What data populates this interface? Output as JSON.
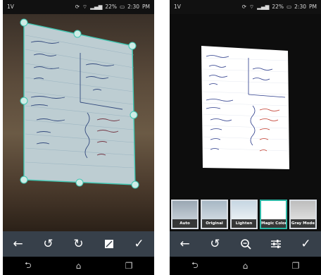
{
  "left_screen": {
    "status": {
      "carrier": "1V",
      "battery_percent": "22%",
      "time": "2:30",
      "ampm": "PM"
    },
    "toolbar": {
      "back_icon": "arrow-left-icon",
      "rotate_left_icon": "rotate-left-icon",
      "rotate_right_icon": "rotate-right-icon",
      "full_frame_icon": "expand-icon",
      "confirm_icon": "check-icon"
    }
  },
  "right_screen": {
    "status": {
      "carrier": "1V",
      "battery_percent": "22%",
      "time": "2:30",
      "ampm": "PM"
    },
    "filters": [
      {
        "label": "Auto",
        "selected": false
      },
      {
        "label": "Original",
        "selected": false
      },
      {
        "label": "Lighten",
        "selected": false
      },
      {
        "label": "Magic Color",
        "selected": true
      },
      {
        "label": "Gray Mode",
        "selected": false
      }
    ],
    "toolbar": {
      "back_icon": "arrow-left-icon",
      "rotate_icon": "rotate-left-icon",
      "zoom_icon": "zoom-icon",
      "adjust_icon": "sliders-icon",
      "confirm_icon": "check-icon"
    }
  },
  "navigation": {
    "back_icon": "nav-back-icon",
    "home_icon": "nav-home-icon",
    "recents_icon": "nav-recents-icon"
  },
  "colors": {
    "accent": "#2fb8a6",
    "toolbar_bg": "#37404a",
    "ink_red": "#c0392b",
    "ink_blue": "#2a3a8a"
  }
}
